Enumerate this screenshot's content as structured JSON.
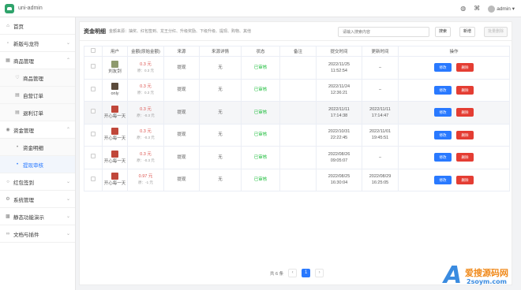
{
  "app": {
    "title": "uni-admin"
  },
  "topbar": {
    "user": "admin"
  },
  "sidebar": {
    "items": [
      {
        "label": "首页"
      },
      {
        "label": "新版与龙符"
      },
      {
        "label": "商品管理"
      },
      {
        "label": "商品管理"
      },
      {
        "label": "自营订单"
      },
      {
        "label": "退利订单"
      },
      {
        "label": "资金管理"
      },
      {
        "label": "资金明细"
      },
      {
        "label": "提现审核"
      },
      {
        "label": "红包签到"
      },
      {
        "label": "系统管理"
      },
      {
        "label": "静态功能演示"
      },
      {
        "label": "文档与插件"
      }
    ]
  },
  "main": {
    "title": "资金明细",
    "subtitle": "金额来源：抽奖、红包签到、龙王分红、升级奖励、下级升级、提现、购物、其他",
    "search_placeholder": "请输入搜索内容",
    "btn_search": "搜索",
    "btn_add": "新增",
    "btn_batch_delete": "批量删除"
  },
  "table": {
    "headers": [
      "用户",
      "金额(原始金额)",
      "来源",
      "来源详情",
      "状态",
      "备注",
      "提交时间",
      "更新时间",
      "操作"
    ],
    "op_edit": "修改",
    "op_delete": "删除",
    "rows": [
      {
        "user": "刘友剑",
        "amount": "0.3 元",
        "orig": "原：0.3 元",
        "source": "提现",
        "detail": "无",
        "status": "已审核",
        "note": "",
        "submit": [
          "2022/11/25",
          "11:52:54"
        ],
        "update": [
          "–",
          ""
        ]
      },
      {
        "user": "only",
        "amount": "0.3 元",
        "orig": "原：0.3 元",
        "source": "提现",
        "detail": "无",
        "status": "已审核",
        "note": "",
        "submit": [
          "2022/11/24",
          "12:36:21"
        ],
        "update": [
          "–",
          ""
        ]
      },
      {
        "user": "开心每一天",
        "amount": "0.3 元",
        "orig": "原：-0.3 元",
        "source": "提现",
        "detail": "无",
        "status": "已审核",
        "note": "",
        "submit": [
          "2022/11/11",
          "17:14:38"
        ],
        "update": [
          "2022/11/11",
          "17:14:47"
        ]
      },
      {
        "user": "开心每一天",
        "amount": "0.3 元",
        "orig": "原：-0.3 元",
        "source": "提现",
        "detail": "无",
        "status": "已审核",
        "note": "",
        "submit": [
          "2022/10/31",
          "22:22:45"
        ],
        "update": [
          "2022/11/01",
          "19:45:51"
        ]
      },
      {
        "user": "开心每一天",
        "amount": "0.3 元",
        "orig": "原：-0.3 元",
        "source": "提现",
        "detail": "无",
        "status": "已审核",
        "note": "",
        "submit": [
          "2022/08/26",
          "09:05:07"
        ],
        "update": [
          "–",
          ""
        ]
      },
      {
        "user": "开心每一天",
        "amount": "0.97 元",
        "orig": "原：-1 元",
        "source": "提现",
        "detail": "无",
        "status": "已审核",
        "note": "",
        "submit": [
          "2022/08/25",
          "16:30:04"
        ],
        "update": [
          "2022/08/29",
          "16:25:05"
        ]
      }
    ]
  },
  "pager": {
    "total": "共 6 条",
    "prev": "‹",
    "current": "1",
    "next": "›"
  },
  "watermark": {
    "brand": "爱搜源码网",
    "url": "2soym.com"
  },
  "colors": {
    "primary": "#2979ff",
    "danger": "#e43d33",
    "success": "#18bc37",
    "amount": "#dd524d"
  }
}
